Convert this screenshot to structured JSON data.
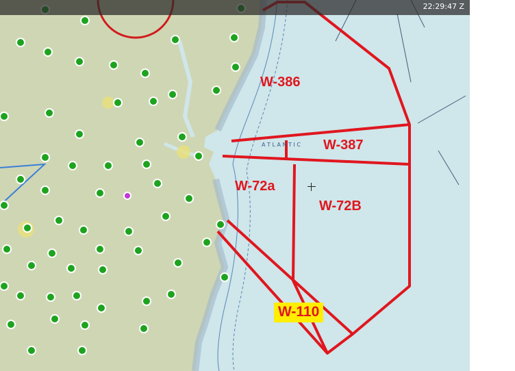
{
  "clock": "22:29:47 Z",
  "ocean_label": "A T L A N T I C",
  "colors": {
    "land": "#cfd6b4",
    "ocean": "#cfe6ea",
    "boundary": "#e0161e",
    "airport": "#1ea31e",
    "highlight": "#ffee00"
  },
  "warning_areas": [
    {
      "id": "W-386",
      "highlighted": false
    },
    {
      "id": "W-387",
      "highlighted": false
    },
    {
      "id": "W-72a",
      "highlighted": false
    },
    {
      "id": "W-72B",
      "highlighted": false
    },
    {
      "id": "W-110",
      "highlighted": true
    }
  ],
  "icons": {
    "airport": "airport-icon",
    "cursor": "crosshair-icon"
  }
}
